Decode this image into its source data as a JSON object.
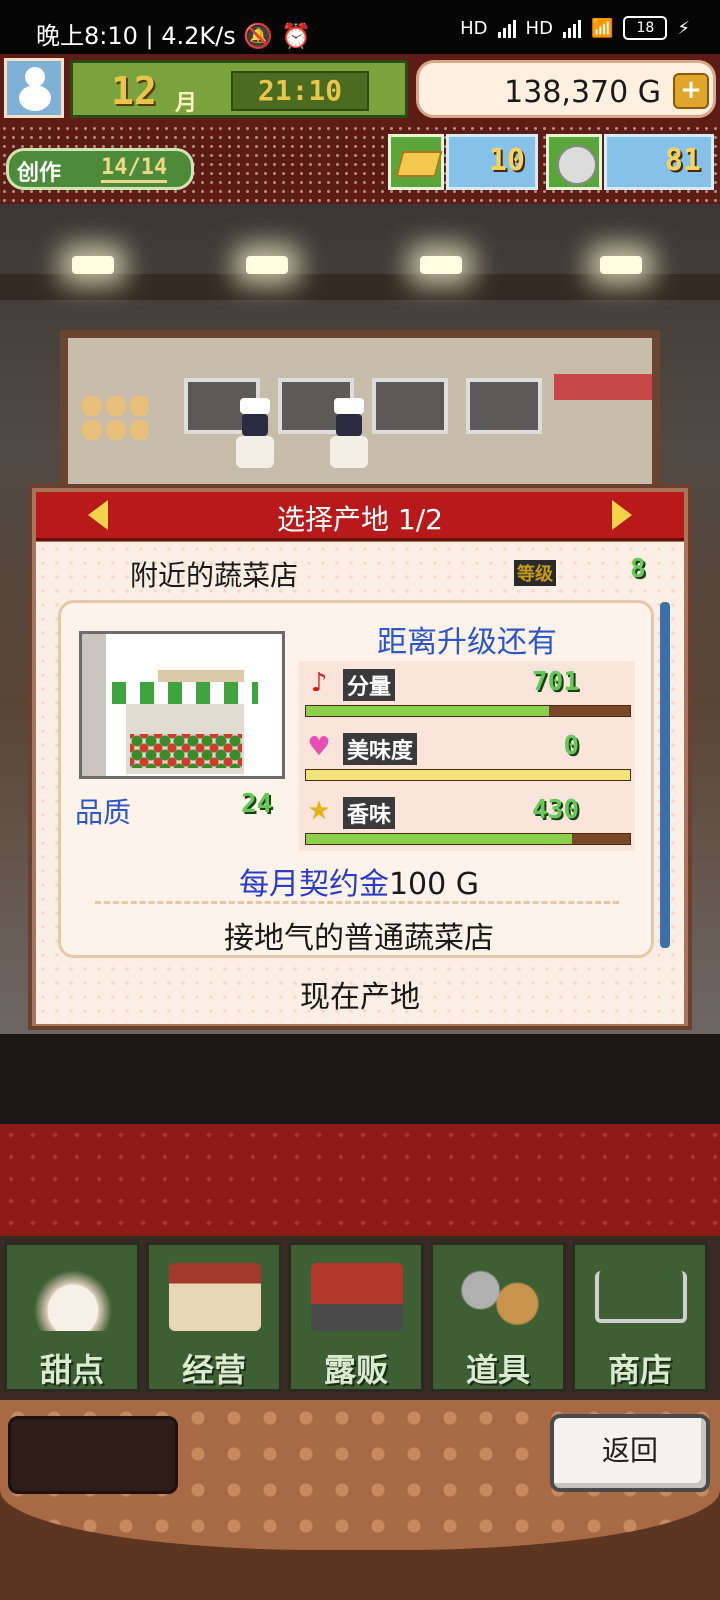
{
  "status_bar": {
    "time": "晚上8:10",
    "network_speed": "4.2K/s",
    "signal1_label": "HD",
    "signal2_label": "HD",
    "battery": "18"
  },
  "hud": {
    "month": "12",
    "month_unit": "月",
    "time": "21:10",
    "gold": "138,370 G",
    "add_gold_label": "+",
    "create_label": "创作",
    "create_value": "14/14",
    "gold_bar_count": "10",
    "medal_count": "81"
  },
  "dialog": {
    "title": "选择产地 1/2",
    "place_name": "附近的蔬菜店",
    "level_tag": "等级",
    "level_value": "8",
    "upgrade_label": "距离升级还有",
    "stats": [
      {
        "name": "分量",
        "value": "701",
        "fill": 0.75,
        "color": "#8bd04a"
      },
      {
        "name": "美味度",
        "value": "0",
        "fill": 1.0,
        "color": "#f2e27a"
      },
      {
        "name": "香味",
        "value": "430",
        "fill": 0.82,
        "color": "#8bd04a"
      }
    ],
    "quality_label": "品质",
    "quality_value": "24",
    "contract_label": "每月契约金",
    "contract_value": "100 G",
    "description": "接地气的普通蔬菜店",
    "current_label": "现在产地"
  },
  "menu": {
    "items": [
      {
        "label": "甜点",
        "icon": "cake-icon"
      },
      {
        "label": "经营",
        "icon": "shop-icon"
      },
      {
        "label": "露贩",
        "icon": "food-truck-icon"
      },
      {
        "label": "道具",
        "icon": "gear-bag-icon"
      },
      {
        "label": "商店",
        "icon": "cart-icon"
      }
    ]
  },
  "footer": {
    "back_label": "返回"
  }
}
